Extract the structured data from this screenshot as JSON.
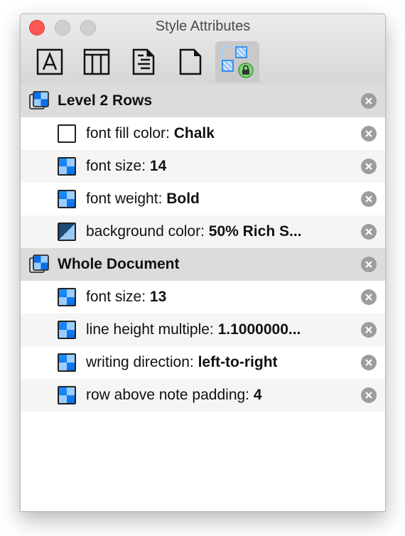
{
  "window": {
    "title": "Style Attributes",
    "controls": [
      "close",
      "minimize",
      "zoom"
    ]
  },
  "toolbar": {
    "tabs": [
      {
        "icon": "text-style-icon",
        "active": false
      },
      {
        "icon": "columns-icon",
        "active": false
      },
      {
        "icon": "document-lines-icon",
        "active": false
      },
      {
        "icon": "blank-document-icon",
        "active": false
      },
      {
        "icon": "locked-styles-icon",
        "active": true
      }
    ]
  },
  "groups": [
    {
      "title": "Level 2 Rows",
      "items": [
        {
          "name": "font fill color: ",
          "value": "Chalk",
          "icon": "empty-swatch"
        },
        {
          "name": "font size: ",
          "value": "14",
          "icon": "style-swatch"
        },
        {
          "name": "font weight: ",
          "value": "Bold",
          "icon": "style-swatch"
        },
        {
          "name": "background color: ",
          "value": "50% Rich S...",
          "icon": "diagonal-swatch"
        }
      ]
    },
    {
      "title": "Whole Document",
      "items": [
        {
          "name": "font size: ",
          "value": "13",
          "icon": "style-swatch"
        },
        {
          "name": "line height multiple: ",
          "value": "1.1000000...",
          "icon": "style-swatch"
        },
        {
          "name": "writing direction: ",
          "value": "left-to-right",
          "icon": "style-swatch"
        },
        {
          "name": "row above note padding: ",
          "value": "4",
          "icon": "style-swatch"
        }
      ]
    }
  ],
  "colors": {
    "accent_blue": "#1c8cff",
    "close_red": "#fc5753",
    "lock_green": "#7ed67a"
  }
}
